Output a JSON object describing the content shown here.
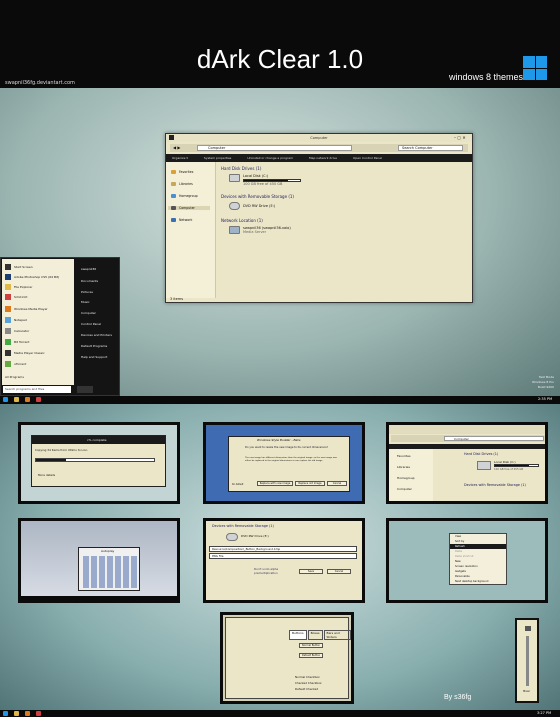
{
  "header": {
    "title": "dArk Clear 1.0",
    "author": "swapnil36fg.deviantart.com",
    "tagline": "windows 8 themes",
    "logo_color": "#1e98e8"
  },
  "explorer": {
    "window_title": "Computer",
    "address": "Computer",
    "search_placeholder": "Search Computer",
    "toolbar": [
      "Organize ▾",
      "System properties",
      "Uninstall or change a program",
      "Map network drive",
      "Open Control Panel"
    ],
    "nav": [
      "Favorites",
      "Libraries",
      "Homegroup",
      "Computer",
      "Network"
    ],
    "group_hdd": "Hard Disk Drives (1)",
    "disk_name": "Local Disk (C:)",
    "disk_free": "100 GB free of 450 GB",
    "disk_used_fraction": 0.78,
    "group_removable": "Devices with Removable Storage (1)",
    "dvd": "DVD RW Drive (E:)",
    "group_network": "Network Location (1)",
    "net_name": "swapnil36 (swapnil36-vaio)",
    "net_sub": "Media Server",
    "status": "3 items"
  },
  "startmenu": {
    "items": [
      "Start Screen",
      "Adobe Photoshop CS5 (64 Bit)",
      "File Explorer",
      "SimCircit",
      "Windows Media Player",
      "Notepad",
      "Calculator",
      "Bit Torrent",
      "Media Player Classic",
      "uTorrent"
    ],
    "all_programs": "All Programs",
    "search_placeholder": "Search programs and files",
    "right": [
      "swapnil36",
      "Documents",
      "Pictures",
      "Music",
      "Computer",
      "Control Panel",
      "Devices and Printers",
      "Default Programs",
      "Help and Support"
    ]
  },
  "taskbar1": {
    "clock": "2:35 PM",
    "watermark": [
      "Test Mode",
      "Windows 8 Pro",
      "Build 9200"
    ]
  },
  "thumbs": {
    "copy_title": "c% complete",
    "copy_text": "Copying 34 items from Ultimo to Lion",
    "more_details": "More details",
    "dialog_title": "Windows Style Builder - Beta",
    "dialog_question": "Do you want to resize the new image to its current dimensions?",
    "dialog_body": "The new image has different dimensions than the original image, so the new image was either be replaced to the original dimensions or can replace the old image.",
    "btn_resize": "Replace with new image",
    "btn_replace": "Replace old image",
    "btn_cancel": "Cancel",
    "do_default": "Do default",
    "explorer_addr": "Computer",
    "hdd2": "Hard Disk Drives (1)",
    "disk2": "Local Disk (C:)",
    "disk2_free": "100 GB free of 455 GB",
    "removable2": "Devices with Removable Storage (1)",
    "nav2": [
      "Favorites",
      "Libraries",
      "Homegroup",
      "Computer",
      "Network"
    ],
    "autoplay_title": "Autoplay",
    "removable3": "Devices with Removable Storage (1)",
    "dvd3": "DVD RW Drive (E:)",
    "path_value": "Resource\\Composition\\_Button_Background.bmp",
    "path_value2": "PNG File",
    "dont_undo": "Don't undo alpha premultiplication",
    "save": "Save",
    "cancel2": "Cancel",
    "context_menu": [
      "View",
      "Sort by",
      "Refresh",
      "Paste",
      "Paste shortcut",
      "New",
      "Screen resolution",
      "Gadgets",
      "Personalize",
      "Next desktop background"
    ],
    "tabs": [
      "Buttons",
      "Boxes",
      "Bars and Sliders"
    ],
    "btn_normal": "Normal Button",
    "btn_default": "Default Button",
    "cb_normal": "Normal Checkbox",
    "cb_checked": "Checked Checkbox",
    "cb_default": "Default Checked",
    "volume_label": "Mixer",
    "signature": "By s36fg",
    "clock2": "3:27 PM"
  }
}
